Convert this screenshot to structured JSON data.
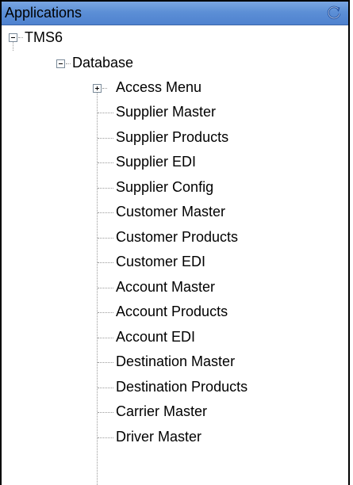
{
  "panel": {
    "title": "Applications",
    "refresh_icon": "refresh-icon",
    "title_color": "#5c8fd6"
  },
  "tree": {
    "root": {
      "label": "TMS6",
      "expanded": true,
      "expander_icon": "collapse-icon"
    },
    "database": {
      "label": "Database",
      "expanded": true,
      "expander_icon": "collapse-icon"
    },
    "access_menu": {
      "label": "Access Menu",
      "expanded": false,
      "expander_icon": "expand-icon"
    },
    "items": [
      {
        "label": "Supplier Master"
      },
      {
        "label": "Supplier Products"
      },
      {
        "label": "Supplier EDI"
      },
      {
        "label": "Supplier Config"
      },
      {
        "label": "Customer Master"
      },
      {
        "label": "Customer Products"
      },
      {
        "label": "Customer EDI"
      },
      {
        "label": "Account Master"
      },
      {
        "label": "Account Products"
      },
      {
        "label": "Account EDI"
      },
      {
        "label": "Destination Master"
      },
      {
        "label": "Destination Products"
      },
      {
        "label": "Carrier Master"
      },
      {
        "label": "Driver Master"
      }
    ]
  }
}
